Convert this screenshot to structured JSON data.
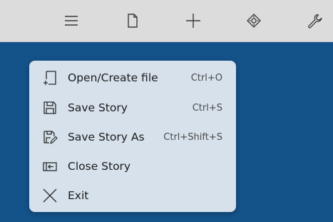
{
  "toolbar": {
    "buttons": [
      {
        "icon": "hamburger-menu-icon"
      },
      {
        "icon": "document-icon"
      },
      {
        "icon": "plus-icon"
      },
      {
        "icon": "diamond-target-icon"
      },
      {
        "icon": "wrench-icon"
      }
    ]
  },
  "menu": {
    "items": [
      {
        "label": "Open/Create file",
        "shortcut": "Ctrl+O",
        "icon": "open-file-icon"
      },
      {
        "label": "Save Story",
        "shortcut": "Ctrl+S",
        "icon": "floppy-disk-icon"
      },
      {
        "label": "Save Story As",
        "shortcut": "Ctrl+Shift+S",
        "icon": "save-as-icon"
      },
      {
        "label": "Close Story",
        "shortcut": "",
        "icon": "close-story-icon"
      },
      {
        "label": "Exit",
        "shortcut": "",
        "icon": "close-icon"
      }
    ]
  },
  "colors": {
    "background": "#14528a",
    "toolbar": "#dcdcdc",
    "menu": "#d6e1ec"
  }
}
